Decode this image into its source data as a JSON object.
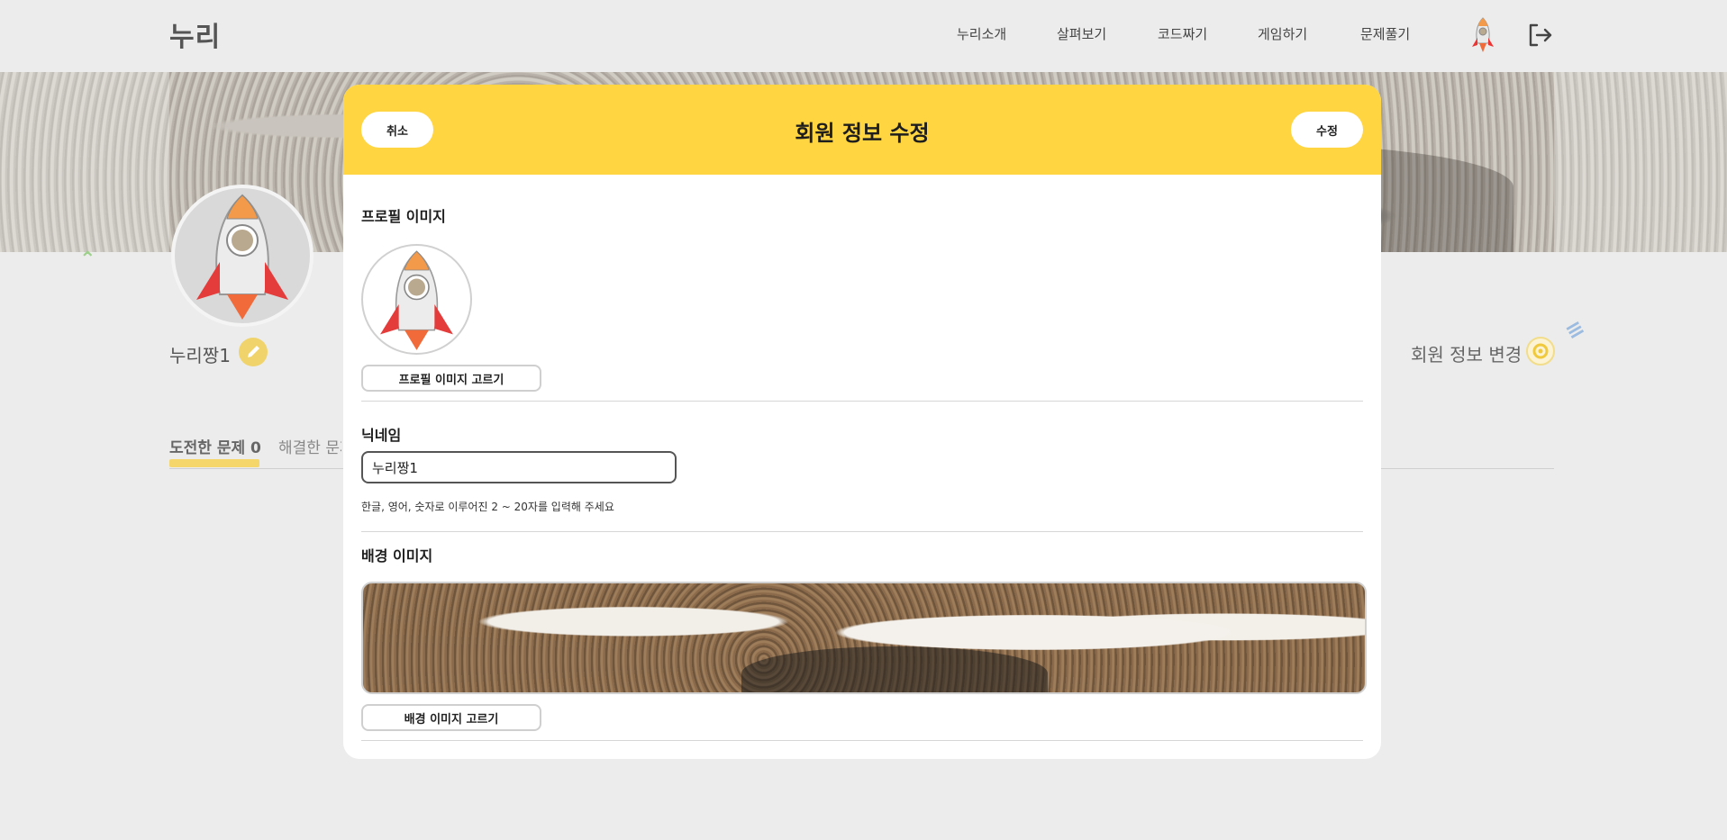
{
  "app": {
    "logo": "누리"
  },
  "nav": {
    "items": [
      {
        "label": "누리소개"
      },
      {
        "label": "살펴보기"
      },
      {
        "label": "코드짜기"
      },
      {
        "label": "게임하기"
      },
      {
        "label": "문제풀기"
      }
    ],
    "avatar_icon": "rocket-icon",
    "logout_icon": "logout-icon"
  },
  "profile_page": {
    "nickname": "누리짱1",
    "edit_icon": "pencil-icon",
    "change_info_label": "회원 정보 변경",
    "change_info_icon": "gear-icon",
    "tabs": [
      {
        "label": "도전한 문제 0"
      },
      {
        "label": "해결한 문제"
      }
    ]
  },
  "modal": {
    "title": "회원 정보 수정",
    "cancel_label": "취소",
    "submit_label": "수정",
    "profile_section_title": "프로필 이미지",
    "choose_profile_label": "프로필 이미지 고르기",
    "nickname_section_title": "닉네임",
    "nickname_value": "누리짱1",
    "nickname_helper": "한글, 영어, 숫자로 이루어진 2 ~ 20자를 입력해 주세요",
    "background_section_title": "배경 이미지",
    "choose_background_label": "배경 이미지 고르기"
  },
  "colors": {
    "accent": "#ffd542",
    "page_bg": "#ececec",
    "tab_underline": "#f5d66b"
  }
}
